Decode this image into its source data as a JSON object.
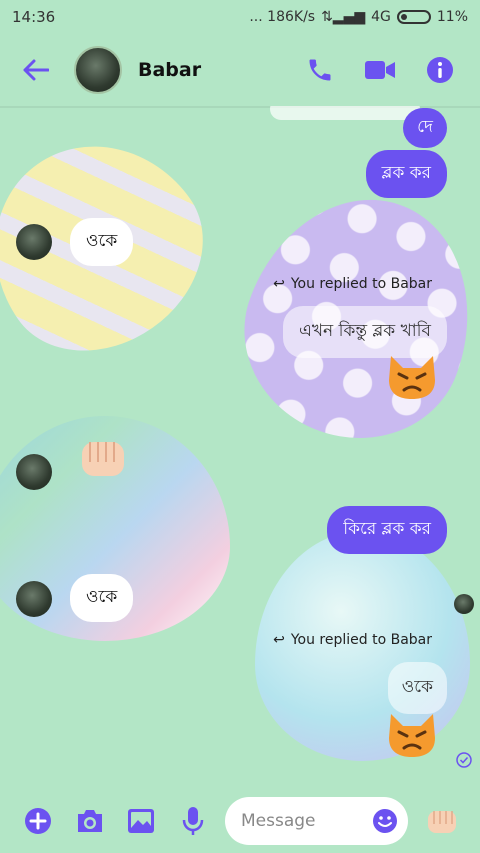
{
  "status": {
    "time": "14:36",
    "speed": "... 186K/s",
    "network": "4G",
    "battery": "11%"
  },
  "header": {
    "contact_name": "Babar"
  },
  "messages": {
    "out1": "দে",
    "out2": "ব্লক কর",
    "in1": "ওকে",
    "reply_note1": "You replied to Babar",
    "quote1": "এখন কিন্তু ব্লক খাবি",
    "in3": "ওকে",
    "out3": "কিরে ব্লক কর",
    "reply_note2": "You replied to Babar",
    "quote2": "ওকে"
  },
  "composer": {
    "placeholder": "Message"
  },
  "colors": {
    "accent": "#6b52f0",
    "background": "#b3e6c6"
  }
}
